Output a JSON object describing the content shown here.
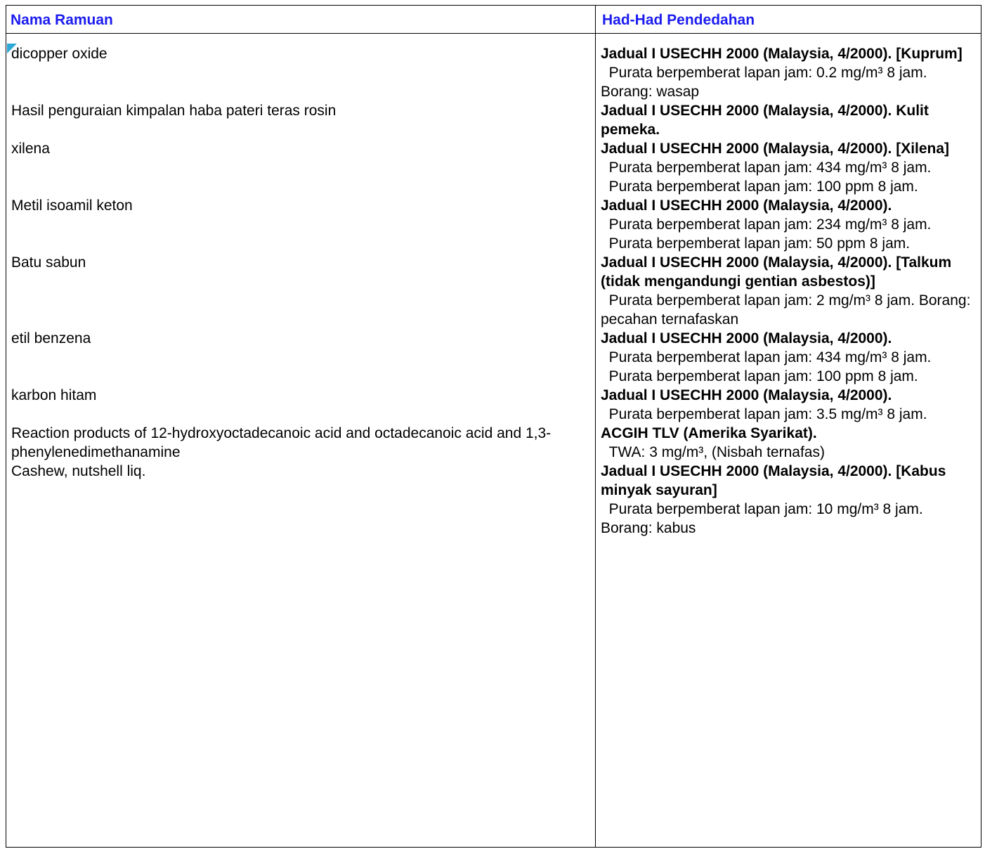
{
  "header": {
    "col_name": "Nama Ramuan",
    "col_limits": "Had-Had Pendedahan",
    "header_color": "#1c1cf0"
  },
  "rows": [
    {
      "name": "dicopper oxide",
      "standard": "Jadual I USECHH 2000 (Malaysia, 4/2000). [Kuprum]",
      "limits": [
        "  Purata berpemberat lapan jam: 0.2 mg/m³ 8 jam. Borang: wasap"
      ]
    },
    {
      "name": "Hasil penguraian kimpalan haba pateri teras rosin",
      "standard": "Jadual I USECHH 2000 (Malaysia, 4/2000). Kulit pemeka.",
      "limits": []
    },
    {
      "name": "xilena",
      "standard": "Jadual I USECHH 2000 (Malaysia, 4/2000). [Xilena]",
      "limits": [
        "  Purata berpemberat lapan jam: 434 mg/m³ 8 jam.",
        "  Purata berpemberat lapan jam: 100 ppm 8 jam."
      ]
    },
    {
      "name": "Metil isoamil keton",
      "standard": "Jadual I USECHH 2000 (Malaysia, 4/2000).",
      "limits": [
        "  Purata berpemberat lapan jam: 234 mg/m³ 8 jam.",
        "  Purata berpemberat lapan jam: 50 ppm 8 jam."
      ]
    },
    {
      "name": "Batu sabun",
      "standard": "Jadual I USECHH 2000 (Malaysia, 4/2000). [Talkum (tidak mengandungi gentian asbestos)]",
      "limits": [
        "  Purata berpemberat lapan jam: 2 mg/m³ 8 jam. Borang: pecahan ternafaskan"
      ]
    },
    {
      "name": "etil benzena",
      "standard": "Jadual I USECHH 2000 (Malaysia, 4/2000).",
      "limits": [
        "  Purata berpemberat lapan jam: 434 mg/m³ 8 jam.",
        "  Purata berpemberat lapan jam: 100 ppm 8 jam."
      ]
    },
    {
      "name": "karbon hitam",
      "standard": "Jadual I USECHH 2000 (Malaysia, 4/2000).",
      "limits": [
        "  Purata berpemberat lapan jam: 3.5 mg/m³ 8 jam."
      ]
    },
    {
      "name": "Reaction products of 12-hydroxyoctadecanoic acid and octadecanoic acid and 1,3-phenylenedimethanamine",
      "standard": "ACGIH TLV (Amerika Syarikat).",
      "limits": [
        "  TWA: 3 mg/m³, (Nisbah ternafas)"
      ]
    },
    {
      "name": "Cashew, nutshell liq.",
      "standard": "Jadual I USECHH 2000 (Malaysia, 4/2000). [Kabus minyak sayuran]",
      "limits": [
        "  Purata berpemberat lapan jam: 10 mg/m³ 8 jam. Borang: kabus"
      ]
    }
  ]
}
